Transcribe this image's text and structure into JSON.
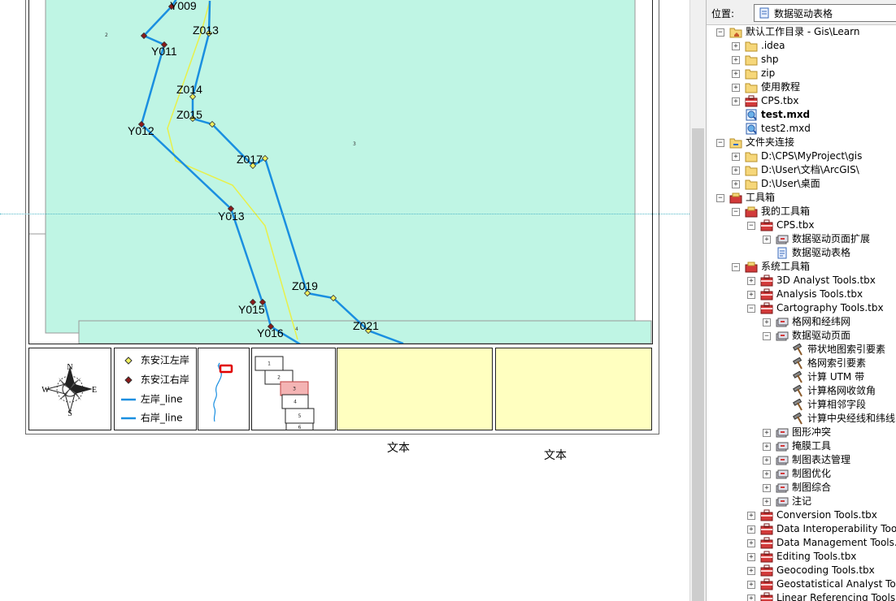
{
  "map": {
    "left_bank_points": [
      {
        "label": "Y009"
      },
      {
        "label": "Y011"
      },
      {
        "label": "Y012"
      },
      {
        "label": "Y013"
      },
      {
        "label": "Y015"
      },
      {
        "label": "Y016"
      }
    ],
    "right_bank_points": [
      {
        "label": "Z013"
      },
      {
        "label": "Z014"
      },
      {
        "label": "Z015"
      },
      {
        "label": "Z017"
      },
      {
        "label": "Z019"
      },
      {
        "label": "Z021"
      }
    ],
    "page_numbers": [
      "2",
      "3",
      "4"
    ],
    "colors": {
      "fill": "#bff5e4",
      "line": "#1a8fe0",
      "yellow_line": "#e8f04a",
      "left_point": "#8b1a1a",
      "right_point": "#f0f060"
    }
  },
  "compass": {
    "n": "N",
    "s": "S",
    "e": "E",
    "w": "W"
  },
  "legend": {
    "items": [
      {
        "label": "东安江左岸"
      },
      {
        "label": "东安江右岸"
      },
      {
        "label": "左岸_line"
      },
      {
        "label": "右岸_line"
      }
    ]
  },
  "index_map": {
    "pages": [
      "1",
      "2",
      "3",
      "4",
      "5",
      "6"
    ],
    "selected": "3"
  },
  "text_elements": [
    "文本",
    "文本"
  ],
  "catalog": {
    "location_label": "位置:",
    "location_value": "数据驱动表格",
    "items": [
      {
        "label": "默认工作目录 - Gis\\Learn",
        "level": 0,
        "exp": "−",
        "icon": "home-folder"
      },
      {
        "label": ".idea",
        "level": 1,
        "exp": "+",
        "icon": "folder"
      },
      {
        "label": "shp",
        "level": 1,
        "exp": "+",
        "icon": "folder"
      },
      {
        "label": "zip",
        "level": 1,
        "exp": "+",
        "icon": "folder"
      },
      {
        "label": "使用教程",
        "level": 1,
        "exp": "+",
        "icon": "folder"
      },
      {
        "label": "CPS.tbx",
        "level": 1,
        "exp": "+",
        "icon": "toolbox"
      },
      {
        "label": "test.mxd",
        "level": 1,
        "exp": "",
        "icon": "mxd",
        "bold": true
      },
      {
        "label": "test2.mxd",
        "level": 1,
        "exp": "",
        "icon": "mxd"
      },
      {
        "label": "文件夹连接",
        "level": 0,
        "exp": "−",
        "icon": "folder-connection"
      },
      {
        "label": "D:\\CPS\\MyProject\\gis",
        "level": 1,
        "exp": "+",
        "icon": "folder"
      },
      {
        "label": "D:\\User\\文档\\ArcGIS\\",
        "level": 1,
        "exp": "+",
        "icon": "folder"
      },
      {
        "label": "D:\\User\\桌面",
        "level": 1,
        "exp": "+",
        "icon": "folder"
      },
      {
        "label": "工具箱",
        "level": 0,
        "exp": "−",
        "icon": "toolboxes"
      },
      {
        "label": "我的工具箱",
        "level": 1,
        "exp": "−",
        "icon": "toolboxes"
      },
      {
        "label": "CPS.tbx",
        "level": 2,
        "exp": "−",
        "icon": "toolbox"
      },
      {
        "label": "数据驱动页面扩展",
        "level": 3,
        "exp": "+",
        "icon": "toolset"
      },
      {
        "label": "数据驱动表格",
        "level": 3,
        "exp": "",
        "icon": "script"
      },
      {
        "label": "系统工具箱",
        "level": 1,
        "exp": "−",
        "icon": "toolboxes"
      },
      {
        "label": "3D Analyst Tools.tbx",
        "level": 2,
        "exp": "+",
        "icon": "toolbox"
      },
      {
        "label": "Analysis Tools.tbx",
        "level": 2,
        "exp": "+",
        "icon": "toolbox"
      },
      {
        "label": "Cartography Tools.tbx",
        "level": 2,
        "exp": "−",
        "icon": "toolbox"
      },
      {
        "label": "格网和经纬网",
        "level": 3,
        "exp": "+",
        "icon": "toolset"
      },
      {
        "label": "数据驱动页面",
        "level": 3,
        "exp": "−",
        "icon": "toolset"
      },
      {
        "label": "带状地图索引要素",
        "level": 4,
        "exp": "",
        "icon": "hammer"
      },
      {
        "label": "格网索引要素",
        "level": 4,
        "exp": "",
        "icon": "hammer"
      },
      {
        "label": "计算 UTM 带",
        "level": 4,
        "exp": "",
        "icon": "hammer"
      },
      {
        "label": "计算格网收敛角",
        "level": 4,
        "exp": "",
        "icon": "hammer"
      },
      {
        "label": "计算相邻字段",
        "level": 4,
        "exp": "",
        "icon": "hammer"
      },
      {
        "label": "计算中央经线和纬线",
        "level": 4,
        "exp": "",
        "icon": "hammer"
      },
      {
        "label": "图形冲突",
        "level": 3,
        "exp": "+",
        "icon": "toolset"
      },
      {
        "label": "掩膜工具",
        "level": 3,
        "exp": "+",
        "icon": "toolset"
      },
      {
        "label": "制图表达管理",
        "level": 3,
        "exp": "+",
        "icon": "toolset"
      },
      {
        "label": "制图优化",
        "level": 3,
        "exp": "+",
        "icon": "toolset"
      },
      {
        "label": "制图综合",
        "level": 3,
        "exp": "+",
        "icon": "toolset"
      },
      {
        "label": "注记",
        "level": 3,
        "exp": "+",
        "icon": "toolset"
      },
      {
        "label": "Conversion Tools.tbx",
        "level": 2,
        "exp": "+",
        "icon": "toolbox"
      },
      {
        "label": "Data Interoperability Tools.tbx",
        "level": 2,
        "exp": "+",
        "icon": "toolbox"
      },
      {
        "label": "Data Management Tools.tbx",
        "level": 2,
        "exp": "+",
        "icon": "toolbox"
      },
      {
        "label": "Editing Tools.tbx",
        "level": 2,
        "exp": "+",
        "icon": "toolbox"
      },
      {
        "label": "Geocoding Tools.tbx",
        "level": 2,
        "exp": "+",
        "icon": "toolbox"
      },
      {
        "label": "Geostatistical Analyst Tools.tbx",
        "level": 2,
        "exp": "+",
        "icon": "toolbox"
      },
      {
        "label": "Linear Referencing Tools.tbx",
        "level": 2,
        "exp": "+",
        "icon": "toolbox"
      }
    ]
  }
}
